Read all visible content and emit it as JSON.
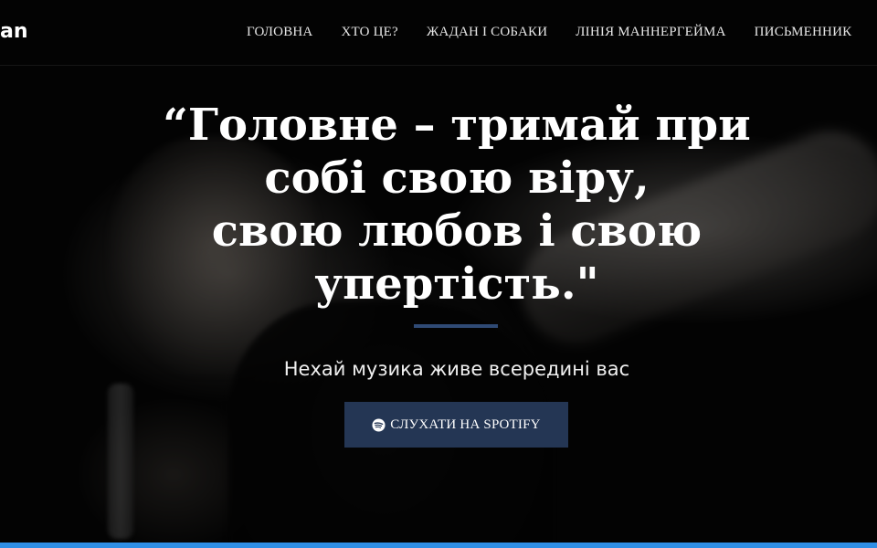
{
  "header": {
    "logo_text": "an",
    "nav": [
      {
        "label": "ГОЛОВНА"
      },
      {
        "label": "ХТО ЦЕ?"
      },
      {
        "label": "ЖАДАН І СОБАКИ"
      },
      {
        "label": "ЛІНІЯ МАННЕРГЕЙМА"
      },
      {
        "label": "ПИСЬМЕННИК"
      }
    ]
  },
  "hero": {
    "quote_lines": [
      "“Головне – тримай при",
      "собі свою віру,",
      "свою любов і свою",
      "упертість.\""
    ],
    "subtitle": "Нехай музика живе всередині вас",
    "cta_label": "СЛУХАТИ НА SPOTIFY",
    "cta_icon": "spotify-icon"
  },
  "colors": {
    "accent": "#243654",
    "divider": "#2f4a75",
    "bottom_bar": "#2f8fe6"
  }
}
